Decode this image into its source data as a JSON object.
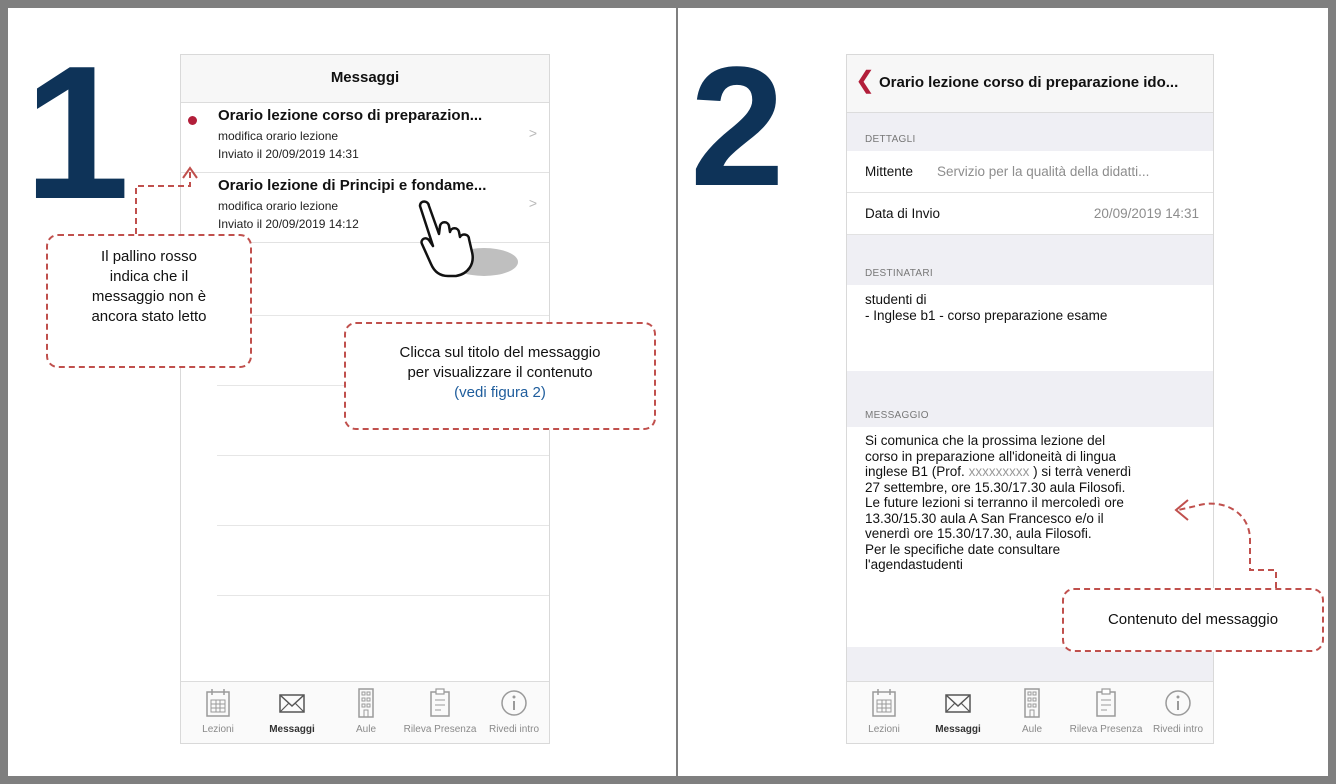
{
  "step1": {
    "number": "1"
  },
  "step2": {
    "number": "2"
  },
  "phone1": {
    "header_title": "Messaggi",
    "messages": [
      {
        "subject": "Orario lezione corso di preparazion...",
        "preview": "modifica orario lezione",
        "date": "Inviato il 20/09/2019 14:31",
        "unread": true
      },
      {
        "subject": "Orario lezione di Principi e fondame...",
        "preview": "modifica orario lezione",
        "date": "Inviato il 20/09/2019 14:12",
        "unread": false
      }
    ],
    "chevron": ">",
    "tabs": [
      {
        "label": "Lezioni",
        "icon": "calendar-icon"
      },
      {
        "label": "Messaggi",
        "icon": "envelope-icon",
        "active": true
      },
      {
        "label": "Aule",
        "icon": "building-icon"
      },
      {
        "label": "Rileva Presenza",
        "icon": "clipboard-icon"
      },
      {
        "label": "Rivedi intro",
        "icon": "info-icon"
      }
    ]
  },
  "phone2": {
    "back_glyph": "❮",
    "header_title": "Orario lezione corso di preparazione ido...",
    "section_dettagli": "DETTAGLI",
    "mittente_label": "Mittente",
    "mittente_value": "Servizio per la qualità della didatti...",
    "data_label": "Data di Invio",
    "data_value": "20/09/2019 14:31",
    "section_destinatari": "DESTINATARI",
    "destinatari_line1": "studenti di",
    "destinatari_line2": "- Inglese b1 - corso preparazione esame",
    "section_messaggio": "MESSAGGIO",
    "message_lines": [
      "Si comunica che la prossima lezione del",
      "corso in preparazione all'idoneità di lingua",
      "inglese B1 (Prof.",
      "xxxxxxxxx",
      ") si terrà venerdì",
      "27 settembre, ore 15.30/17.30 aula Filosofi.",
      "Le future lezioni si terranno il mercoledì ore",
      "13.30/15.30 aula A San Francesco e/o il",
      "venerdì ore 15.30/17.30, aula Filosofi.",
      "Per le specifiche date consultare",
      "l'agendastudenti"
    ]
  },
  "callouts": {
    "red_dot": [
      "Il pallino rosso",
      "indica che il",
      "messaggio non è",
      "ancora stato letto"
    ],
    "click_title": [
      "Clicca sul titolo del messaggio",
      "per visualizzare il contenuto"
    ],
    "click_link": "(vedi figura 2)",
    "content": "Contenuto del messaggio"
  },
  "colors": {
    "accent_red": "#b21e3a",
    "number_blue": "#0e3358",
    "callout_border": "#c0504d",
    "link_blue": "#1f5d9c"
  }
}
